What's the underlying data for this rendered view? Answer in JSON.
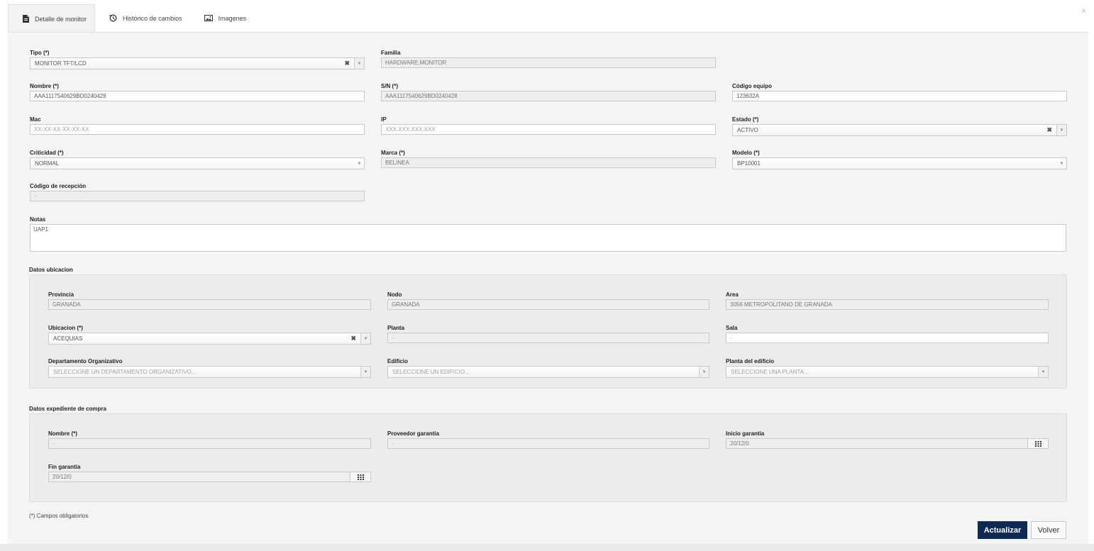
{
  "window": {
    "close_glyph": "×"
  },
  "tabs": [
    {
      "label": "Detalle de monitor",
      "icon": "document-icon",
      "active": true
    },
    {
      "label": "Histórico de cambios",
      "icon": "history-icon",
      "active": false
    },
    {
      "label": "Imagenes",
      "icon": "image-icon",
      "active": false
    }
  ],
  "form": {
    "tipo": {
      "label": "Tipo (*)",
      "value": "MONITOR TFT/LCD"
    },
    "familia": {
      "label": "Familia",
      "value": "HARDWARE.MONITOR"
    },
    "nombre": {
      "label": "Nombre (*)",
      "value": "AAA1117540629BD0240428"
    },
    "sn": {
      "label": "S/N (*)",
      "value": "AAA1117540629BD0240428"
    },
    "codigo_equipo": {
      "label": "Código equipo",
      "value": "123632A"
    },
    "mac": {
      "label": "Mac",
      "placeholder": "XX-XX-XX-XX-XX-XX"
    },
    "ip": {
      "label": "IP",
      "placeholder": "XXX.XXX.XXX.XXX"
    },
    "estado": {
      "label": "Estado (*)",
      "value": "ACTIVO"
    },
    "criticidad": {
      "label": "Criticidad (*)",
      "value": "NORMAL"
    },
    "marca": {
      "label": "Marca (*)",
      "value": "BELINEA"
    },
    "modelo": {
      "label": "Modelo (*)",
      "value": "BP10001"
    },
    "codigo_recepcion": {
      "label": "Código de recepción",
      "value": "-"
    },
    "notas": {
      "label": "Notas",
      "value": "UAP1"
    }
  },
  "ubicacion": {
    "title": "Datos ubicacion",
    "provincia": {
      "label": "Provincia",
      "value": "GRANADA"
    },
    "nodo": {
      "label": "Nodo",
      "value": "GRANADA"
    },
    "area": {
      "label": "Area",
      "value": "3056 METROPOLITANO DE GRANADA"
    },
    "ubicacion": {
      "label": "Ubicacion (*)",
      "value": "ACEQUIAS"
    },
    "planta": {
      "label": "Planta",
      "value": "-"
    },
    "sala": {
      "label": "Sala",
      "value": "-"
    },
    "departamento": {
      "label": "Departamento Organizativo",
      "placeholder": "SELECCIONE UN DEPARTAMENTO ORGANIZATIVO..."
    },
    "edificio": {
      "label": "Edificio",
      "placeholder": "SELECCIONE UN EDIFICIO..."
    },
    "planta_edificio": {
      "label": "Planta del edificio",
      "placeholder": "SELECCIONE UNA PLANTA..."
    }
  },
  "compra": {
    "title": "Datos expediente de compra",
    "nombre": {
      "label": "Nombre (*)",
      "value": "-"
    },
    "proveedor": {
      "label": "Proveedor garantia",
      "value": "-"
    },
    "inicio": {
      "label": "Inicio garantia",
      "value": "20/12/0"
    },
    "fin": {
      "label": "Fin garantia",
      "value": "20/12/0"
    }
  },
  "footer": {
    "note": "(*) Campos obligatorios",
    "update_label": "Actualizar",
    "back_label": "Volver"
  },
  "colors": {
    "primary": "#0f2a52",
    "panel": "#f4f4f4",
    "box": "#ececec"
  }
}
